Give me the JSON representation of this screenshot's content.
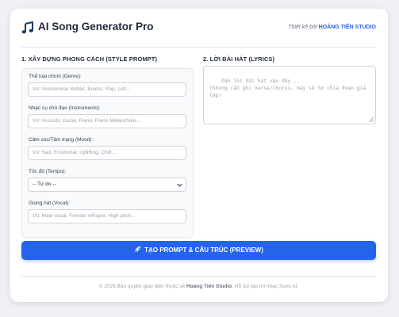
{
  "header": {
    "logo_icon": "music-notes-icon",
    "title": "AI Song Generator Pro",
    "credit_prefix": "Thiết kế bởi",
    "credit_name": "HOÀNG TIẾN STUDIO"
  },
  "style_section": {
    "title": "1. XÂY DỰNG PHONG CÁCH (STYLE PROMPT)",
    "fields": [
      {
        "label": "Thể loại chính (Genre):",
        "placeholder": "Vd: Vietnamese Ballad, Bolero, Rap, Lofi..."
      },
      {
        "label": "Nhạc cụ chủ đạo (Instruments):",
        "placeholder": "Vd: Acoustic Guitar, Piano, Piano Melancholic..."
      },
      {
        "label": "Cảm xúc/Tâm trạng (Mood):",
        "placeholder": "Vd: Sad, Emotional, Uplifting, Chill..."
      },
      {
        "label": "Tốc độ (Tempo):",
        "selected": "-- Tự do --"
      },
      {
        "label": "Giọng hát (Vocal):",
        "placeholder": "Vd: Male vocal, Female whisper, High pitch..."
      }
    ]
  },
  "lyrics_section": {
    "title": "2. LỜI BÀI HÁT (LYRICS)",
    "placeholder": "Dán lời bài hát vào đây...\n(Không cần ghi Verse/Chorus, máy sẽ tự chia đoạn giả lập)"
  },
  "generate_button": {
    "icon": "rocket-icon",
    "label": "TẠO PROMPT & CẤU TRÚC (PREVIEW)"
  },
  "footer": {
    "prefix": "© 2025 Bản quyền giao diện thuộc về",
    "owner": "Hoàng Tiến Studio",
    "suffix": ". Hỗ trợ tạo lời nhạc Suno AI."
  },
  "colors": {
    "accent": "#2563eb",
    "background": "#eef0f4"
  }
}
